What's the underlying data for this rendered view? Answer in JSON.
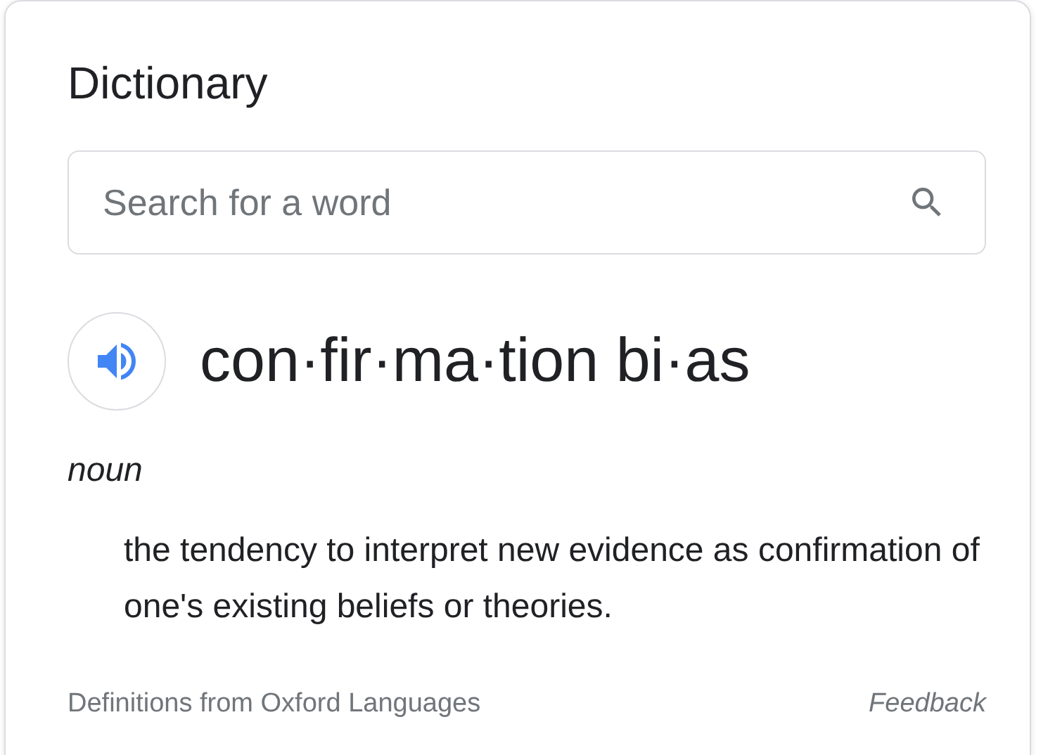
{
  "title": "Dictionary",
  "search": {
    "placeholder": "Search for a word"
  },
  "entry": {
    "headword": "con·fir·ma·tion bi·as",
    "part_of_speech": "noun",
    "definitions": [
      "the tendency to interpret new evidence as confirmation of one's existing beliefs or theories."
    ]
  },
  "footer": {
    "source": "Definitions from Oxford Languages",
    "feedback": "Feedback"
  }
}
